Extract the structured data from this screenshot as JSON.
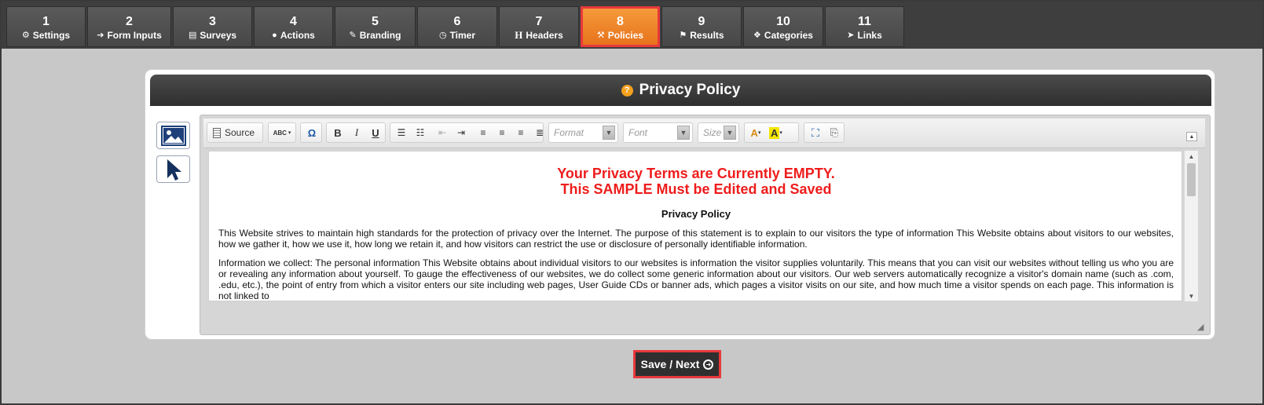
{
  "tabs": [
    {
      "num": "1",
      "label": "Settings",
      "icon": "gear-icon",
      "glyph": "⚙"
    },
    {
      "num": "2",
      "label": "Form Inputs",
      "icon": "sign-in-icon",
      "glyph": "➔"
    },
    {
      "num": "3",
      "label": "Surveys",
      "icon": "list-icon",
      "glyph": "▤"
    },
    {
      "num": "4",
      "label": "Actions",
      "icon": "user-icon",
      "glyph": "●"
    },
    {
      "num": "5",
      "label": "Branding",
      "icon": "brush-icon",
      "glyph": "✎"
    },
    {
      "num": "6",
      "label": "Timer",
      "icon": "clock-icon",
      "glyph": "◷"
    },
    {
      "num": "7",
      "label": "Headers",
      "icon": "header-icon",
      "glyph": "H"
    },
    {
      "num": "8",
      "label": "Policies",
      "icon": "gavel-icon",
      "glyph": "⚒"
    },
    {
      "num": "9",
      "label": "Results",
      "icon": "flag-icon",
      "glyph": "⚑"
    },
    {
      "num": "10",
      "label": "Categories",
      "icon": "cubes-icon",
      "glyph": "❖"
    },
    {
      "num": "11",
      "label": "Links",
      "icon": "pointer-icon",
      "glyph": "➤"
    }
  ],
  "active_tab": "8",
  "panel": {
    "title": "Privacy Policy",
    "help_glyph": "?"
  },
  "toolbar": {
    "source_label": "Source",
    "spell_label": "ABC",
    "special_char": "Ω",
    "bold": "B",
    "italic": "I",
    "underline": "U",
    "format_placeholder": "Format",
    "font_placeholder": "Font",
    "size_placeholder": "Size",
    "text_color": "A",
    "bg_color": "A"
  },
  "content": {
    "warning_line1": "Your Privacy Terms are Currently EMPTY.",
    "warning_line2": "This SAMPLE Must be Edited and Saved",
    "heading": "Privacy Policy",
    "para1": "This Website strives to maintain high standards for the protection of privacy over the Internet. The purpose of this statement is to explain to our visitors the type of information This Website obtains about visitors to our websites, how we gather it, how we use it, how long we retain it, and how visitors can restrict the use or disclosure of personally identifiable information.",
    "para2": "Information we collect: The personal information This Website obtains about individual visitors to our websites is information the visitor supplies voluntarily. This means that you can visit our websites without telling us who you are or revealing any information about yourself. To gauge the effectiveness of our websites, we do collect some generic information about our visitors. Our web servers automatically recognize a visitor's domain name (such as .com, .edu, etc.), the point of entry from which a visitor enters our site including web pages, User Guide CDs or banner ads, which pages a visitor visits on our site, and how much time a visitor spends on each page. This information is not linked to"
  },
  "save_button": {
    "label": "Save / Next",
    "glyph": "➜"
  },
  "colors": {
    "accent": "#f0821f",
    "highlight": "#e8393b",
    "warning": "#ee1c1c",
    "dark": "#2f2f2f"
  }
}
